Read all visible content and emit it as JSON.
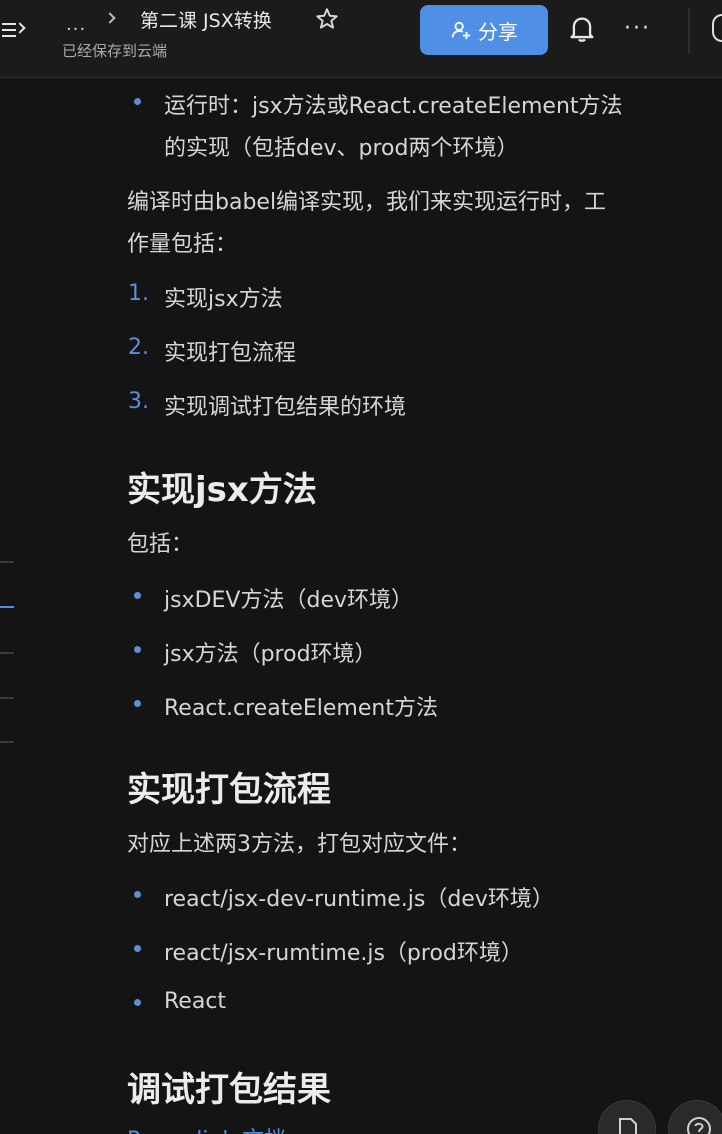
{
  "header": {
    "ellipsis": "...",
    "title": "第二课 JSX转换",
    "save_status": "已经保存到云端",
    "share_label": "分享",
    "more": "···"
  },
  "content": {
    "runtime_bullet_line1": "运行时：jsx方法或React.createElement方法",
    "runtime_bullet_line2": "的实现（包括dev、prod两个环境）",
    "intro_line1": "编译时由babel编译实现，我们来实现运行时，工",
    "intro_line2": "作量包括：",
    "tasks": [
      {
        "num": "1.",
        "text": "实现jsx方法"
      },
      {
        "num": "2.",
        "text": "实现打包流程"
      },
      {
        "num": "3.",
        "text": "实现调试打包结果的环境"
      }
    ],
    "section1": {
      "heading": "实现jsx方法",
      "lead": "包括：",
      "items": [
        "jsxDEV方法（dev环境）",
        "jsx方法（prod环境）",
        "React.createElement方法"
      ]
    },
    "section2": {
      "heading": "实现打包流程",
      "lead": "对应上述两3方法，打包对应文件：",
      "items": [
        "react/jsx-dev-runtime.js（dev环境）",
        "react/jsx-rumtime.js（prod环境）",
        "React"
      ]
    },
    "section3": {
      "heading": "调试打包结果",
      "link_partial": "Pnpm link 文档"
    }
  },
  "colors": {
    "accent": "#4f8fe6",
    "bullet": "#5b8fd8",
    "background": "#141414",
    "header_bg": "#1b1b1b"
  },
  "icons": [
    "menu-collapse-icon",
    "chevron-right-icon",
    "star-icon",
    "add-user-icon",
    "bell-icon",
    "more-icon",
    "document-icon",
    "help-icon"
  ]
}
